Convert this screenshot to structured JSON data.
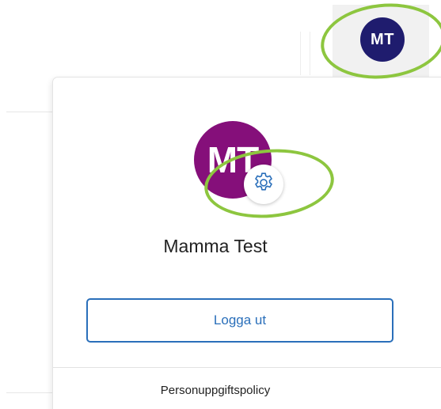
{
  "header": {
    "avatar_initials": "MT",
    "avatar_color": "#1f1c6e"
  },
  "profile_menu": {
    "avatar_initials": "MT",
    "avatar_color": "#850f7a",
    "settings_icon": "gear-icon",
    "user_name": "Mamma Test",
    "logout_label": "Logga ut",
    "privacy_link": "Personuppgiftspolicy"
  },
  "colors": {
    "highlight": "#8dc63f",
    "accent": "#2a6fba"
  }
}
